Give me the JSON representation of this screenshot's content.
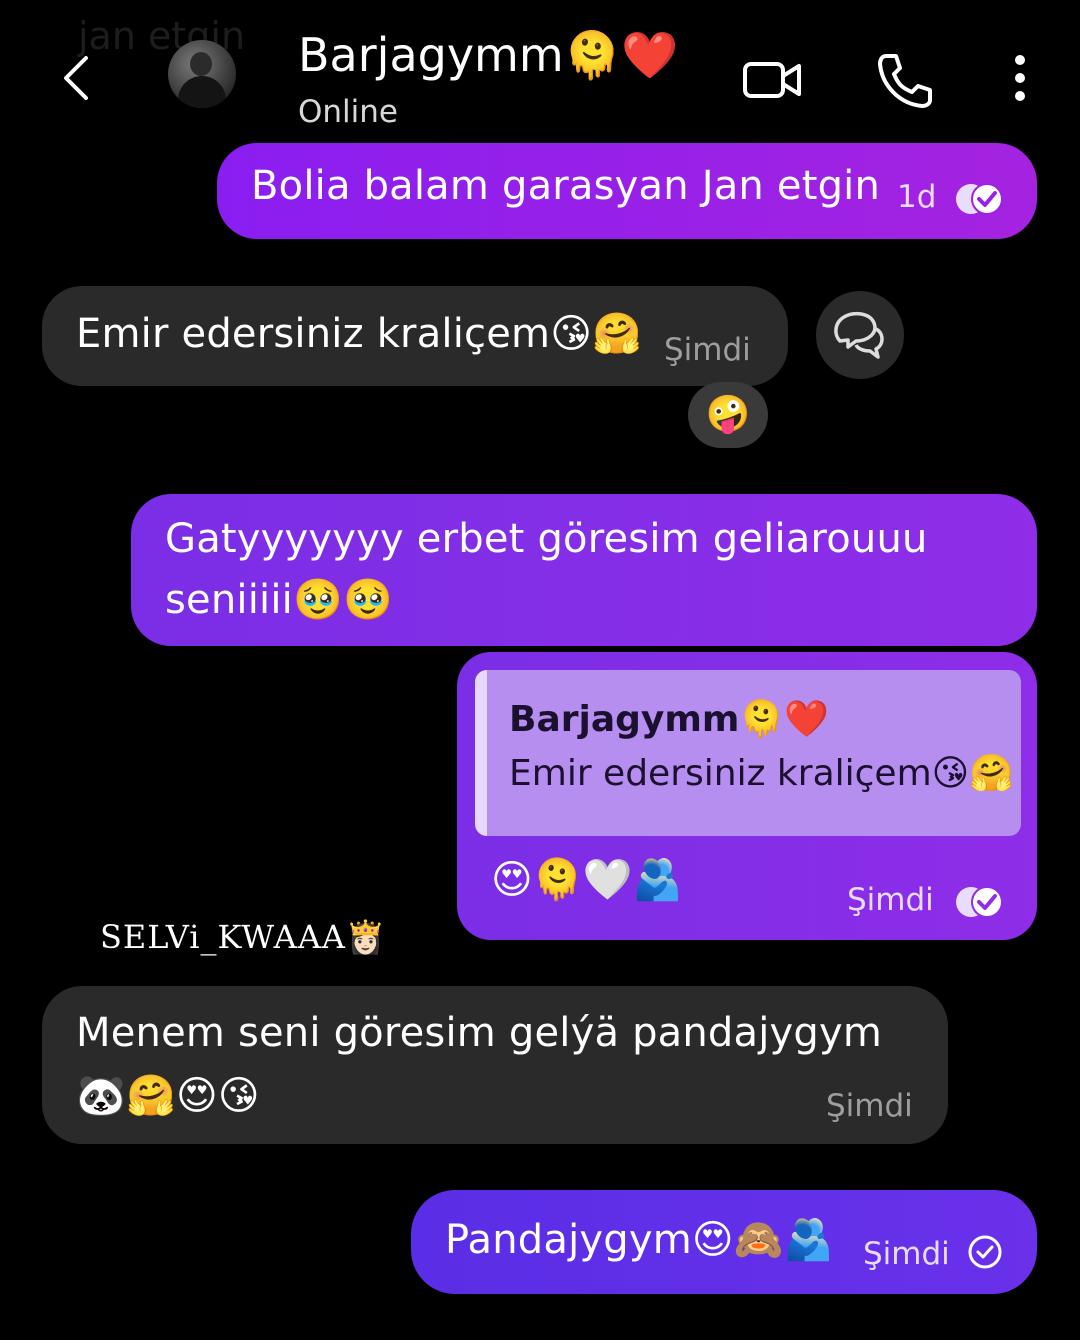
{
  "header": {
    "ghost_text": "jan etgin",
    "contact_name": "Barjagymm",
    "contact_emoji": "🫠❤️",
    "status": "Online"
  },
  "messages": [
    {
      "dir": "out",
      "text": "Bolia balam garasyan Jan etgin",
      "time": "1d",
      "status": "read"
    },
    {
      "dir": "in",
      "text": "Emir edersiniz kraliçem",
      "emoji": "😘🤗",
      "time": "Şimdi",
      "reaction": "🤪"
    },
    {
      "dir": "out",
      "line1": "Gatyyyyyyy erbet göresim geliarouuu",
      "line2": "seniiiii",
      "emoji": "🥹🥹"
    },
    {
      "dir": "out",
      "quote_name": "Barjagymm",
      "quote_name_emoji": "🫠❤️",
      "quote_text": "Emir edersiniz kraliçem",
      "quote_emoji": "😘🤗",
      "emoji": "😍🫠🤍🫂",
      "time": "Şimdi",
      "status": "read"
    },
    {
      "dir": "in",
      "line1": "Menem seni göresim gelýä pandajygym",
      "emoji": "🐼🤗😍😘",
      "time": "Şimdi"
    },
    {
      "dir": "out",
      "text": "Pandajygym",
      "emoji": "😍🙈🫂",
      "time": "Şimdi",
      "status": "sent"
    }
  ],
  "watermark": {
    "text": "SELVi_KWAAA",
    "emoji": "👸🏻"
  },
  "colors": {
    "outgoing": "#9a22e8",
    "incoming": "#2a2a2a",
    "background": "#000000"
  },
  "icons": [
    "back-arrow-icon",
    "video-call-icon",
    "phone-icon",
    "more-vertical-icon",
    "reply-icon",
    "double-check-icon",
    "check-circle-icon"
  ]
}
